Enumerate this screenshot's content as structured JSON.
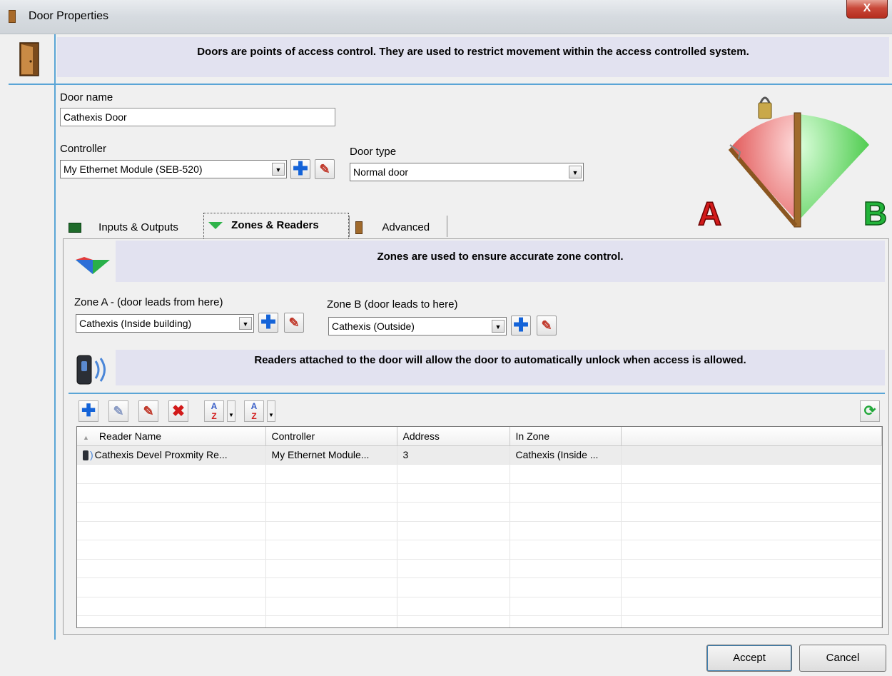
{
  "window": {
    "title": "Door Properties",
    "close_label": "X"
  },
  "header": {
    "info": "Doors are points of access control. They are used to restrict movement within the access controlled system."
  },
  "door_name": {
    "label": "Door name",
    "value": "Cathexis Door"
  },
  "controller": {
    "label": "Controller",
    "value": "My Ethernet Module (SEB-520)"
  },
  "door_type": {
    "label": "Door type",
    "value": "Normal door"
  },
  "diagram": {
    "side_a": "A",
    "side_b": "B"
  },
  "tabs": [
    {
      "label": "Inputs & Outputs",
      "icon": "io-icon"
    },
    {
      "label": "Zones & Readers",
      "icon": "zones-icon",
      "active": true
    },
    {
      "label": "Advanced",
      "icon": "door-icon"
    }
  ],
  "zones": {
    "info": "Zones are used to ensure accurate zone control.",
    "zone_a": {
      "label": "Zone A - (door leads from here)",
      "value": "Cathexis (Inside building)"
    },
    "zone_b": {
      "label": "Zone B (door leads to here)",
      "value": "Cathexis (Outside)"
    }
  },
  "readers": {
    "info": "Readers attached to the door will allow the door to automatically unlock when access is allowed.",
    "columns": [
      "Reader Name",
      "Controller",
      "Address",
      "In Zone",
      ""
    ],
    "rows": [
      [
        "Cathexis Devel Proxmity Re...",
        "My Ethernet Module...",
        "3",
        "Cathexis (Inside ...",
        ""
      ]
    ]
  },
  "buttons": {
    "accept": "Accept",
    "cancel": "Cancel"
  },
  "colors": {
    "accent_line": "#5aa5d6",
    "banner_bg": "#e2e2f0",
    "side_a": "#d21a1a",
    "side_b": "#22b33a"
  }
}
